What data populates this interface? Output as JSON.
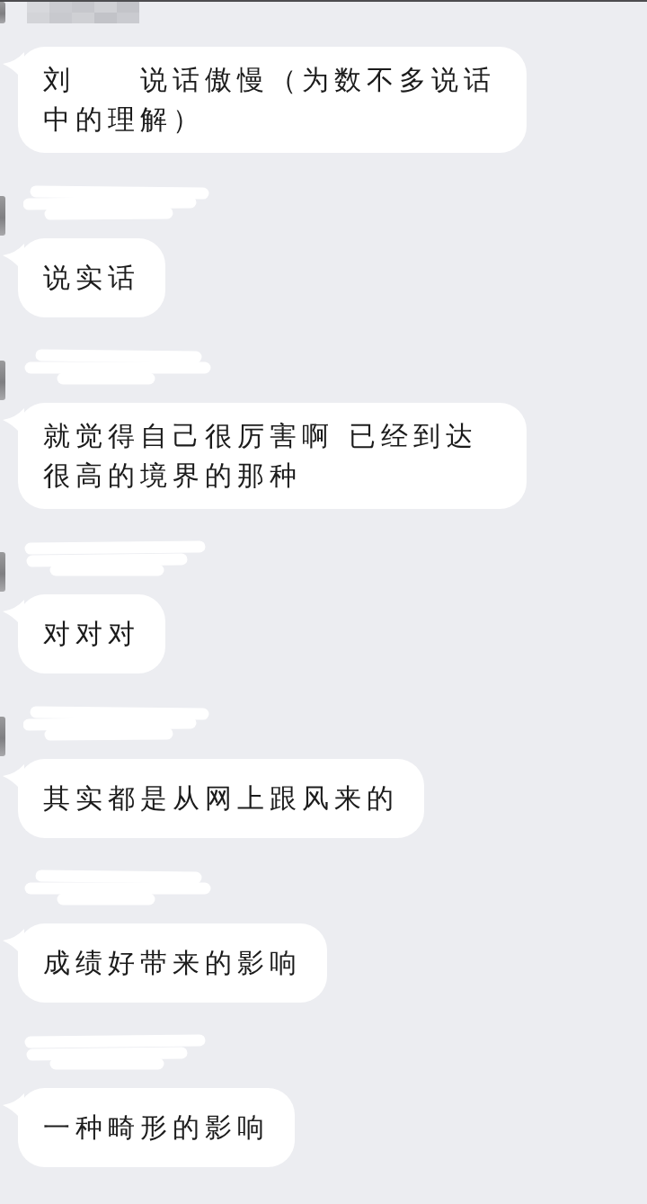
{
  "messages": [
    {
      "kind": "mosaic",
      "avatar_edge": true,
      "text": "刘　　说话傲慢（为数不多说话中的理解）"
    },
    {
      "kind": "smudge",
      "avatar_edge": true,
      "text": "说实话"
    },
    {
      "kind": "smudge",
      "avatar_edge": true,
      "text": "就觉得自己很厉害啊 已经到达很高的境界的那种"
    },
    {
      "kind": "smudge",
      "avatar_edge": true,
      "text": "对对对"
    },
    {
      "kind": "smudge",
      "avatar_edge": true,
      "text": "其实都是从网上跟风来的"
    },
    {
      "kind": "smudge",
      "avatar_edge": false,
      "text": "成绩好带来的影响"
    },
    {
      "kind": "smudge",
      "avatar_edge": false,
      "text": "一种畸形的影响"
    }
  ]
}
